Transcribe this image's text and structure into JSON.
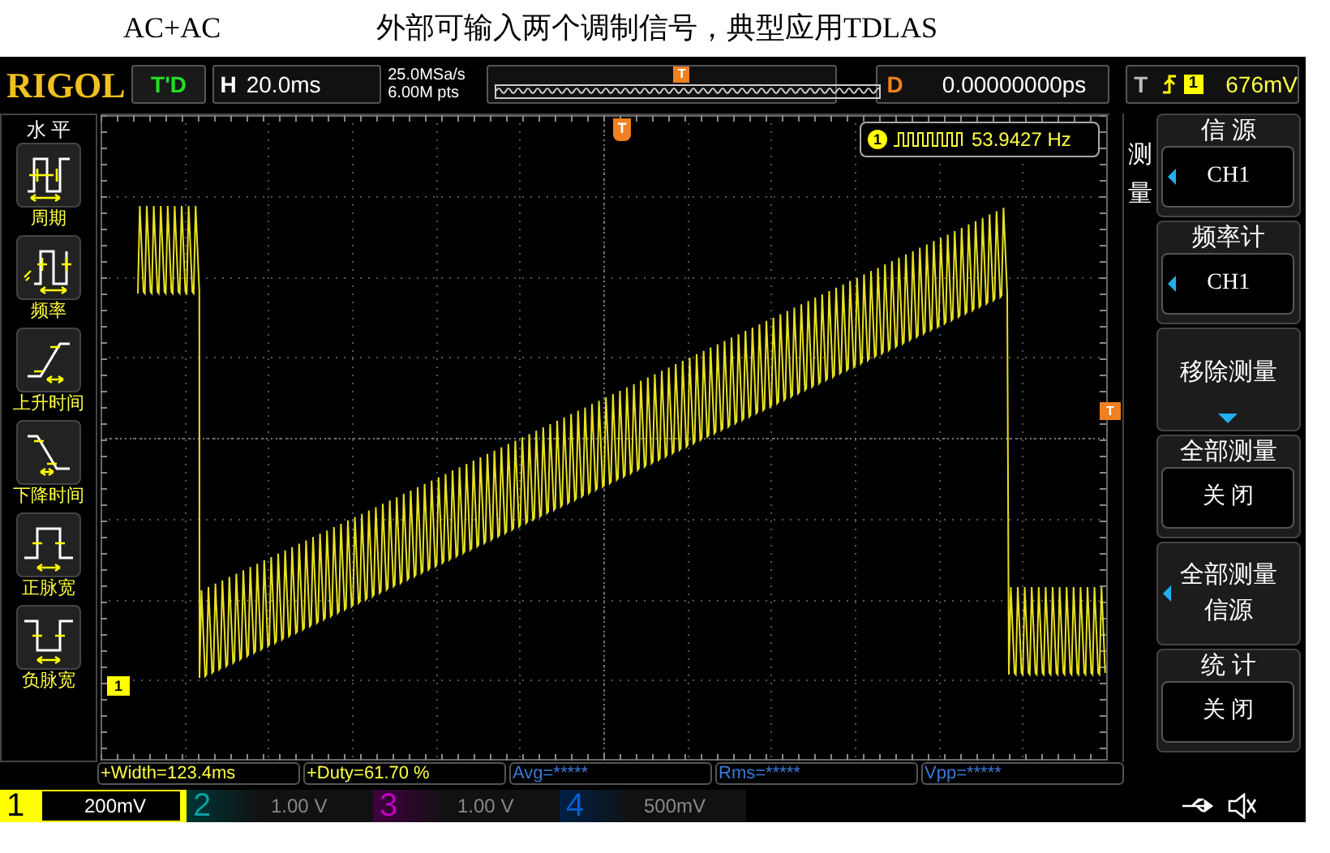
{
  "caption": {
    "left": "AC+AC",
    "right": "外部可输入两个调制信号，典型应用TDLAS"
  },
  "top_bar": {
    "logo": "RIGOL",
    "run_state": "T'D",
    "timebase_label": "H",
    "timebase": "20.0ms",
    "sample_rate": "25.0MSa/s",
    "memory_depth": "6.00M pts",
    "overview_marker": "T",
    "delay_label": "D",
    "delay": "0.00000000ps",
    "trigger_label": "T",
    "trigger_channel": "1",
    "trigger_level": "676mV"
  },
  "left_menu": {
    "title": "水 平",
    "items": [
      {
        "kind": "period",
        "label": "周期"
      },
      {
        "kind": "frequency",
        "label": "频率"
      },
      {
        "kind": "rise",
        "label": "上升时间"
      },
      {
        "kind": "fall",
        "label": "下降时间"
      },
      {
        "kind": "pos_width",
        "label": "正脉宽"
      },
      {
        "kind": "neg_width",
        "label": "负脉宽"
      }
    ]
  },
  "screen": {
    "trigger_position_marker": "T",
    "trigger_level_marker": "T",
    "channel_marker": "1",
    "frequency_readout": {
      "channel": "1",
      "value": "53.9427 Hz"
    }
  },
  "right_menu": {
    "title": "测量",
    "items": [
      {
        "kind": "value",
        "label": "信 源",
        "value": "CH1",
        "left_arrow": true,
        "down_arrow": false
      },
      {
        "kind": "value",
        "label": "频率计",
        "value": "CH1",
        "left_arrow": true,
        "down_arrow": false
      },
      {
        "kind": "action",
        "label": "移除测量",
        "left_arrow": false,
        "down_arrow": true
      },
      {
        "kind": "value",
        "label": "全部测量",
        "value": "关 闭",
        "left_arrow": false,
        "down_arrow": false
      },
      {
        "kind": "action",
        "label": "全部测量信源",
        "left_arrow": true,
        "down_arrow": false
      },
      {
        "kind": "value",
        "label": "统 计",
        "value": "关 闭",
        "left_arrow": false,
        "down_arrow": false
      }
    ]
  },
  "measurements": [
    {
      "text": "+Width=123.4ms",
      "color": "#ffff40"
    },
    {
      "text": "+Duty=61.70 %",
      "color": "#ffff40"
    },
    {
      "text": "Avg=*****",
      "color": "#3a78d8"
    },
    {
      "text": "Rms=*****",
      "color": "#3a78d8"
    },
    {
      "text": "Vpp=*****",
      "color": "#3a78d8"
    }
  ],
  "channels": [
    {
      "number": "1",
      "scale": "200mV",
      "on": true,
      "color": "#ffff00"
    },
    {
      "number": "2",
      "scale": "1.00 V",
      "on": false,
      "color": "#00a0a0"
    },
    {
      "number": "3",
      "scale": "1.00 V",
      "on": false,
      "color": "#c000c0"
    },
    {
      "number": "4",
      "scale": "500mV",
      "on": false,
      "color": "#0060d0"
    }
  ]
}
